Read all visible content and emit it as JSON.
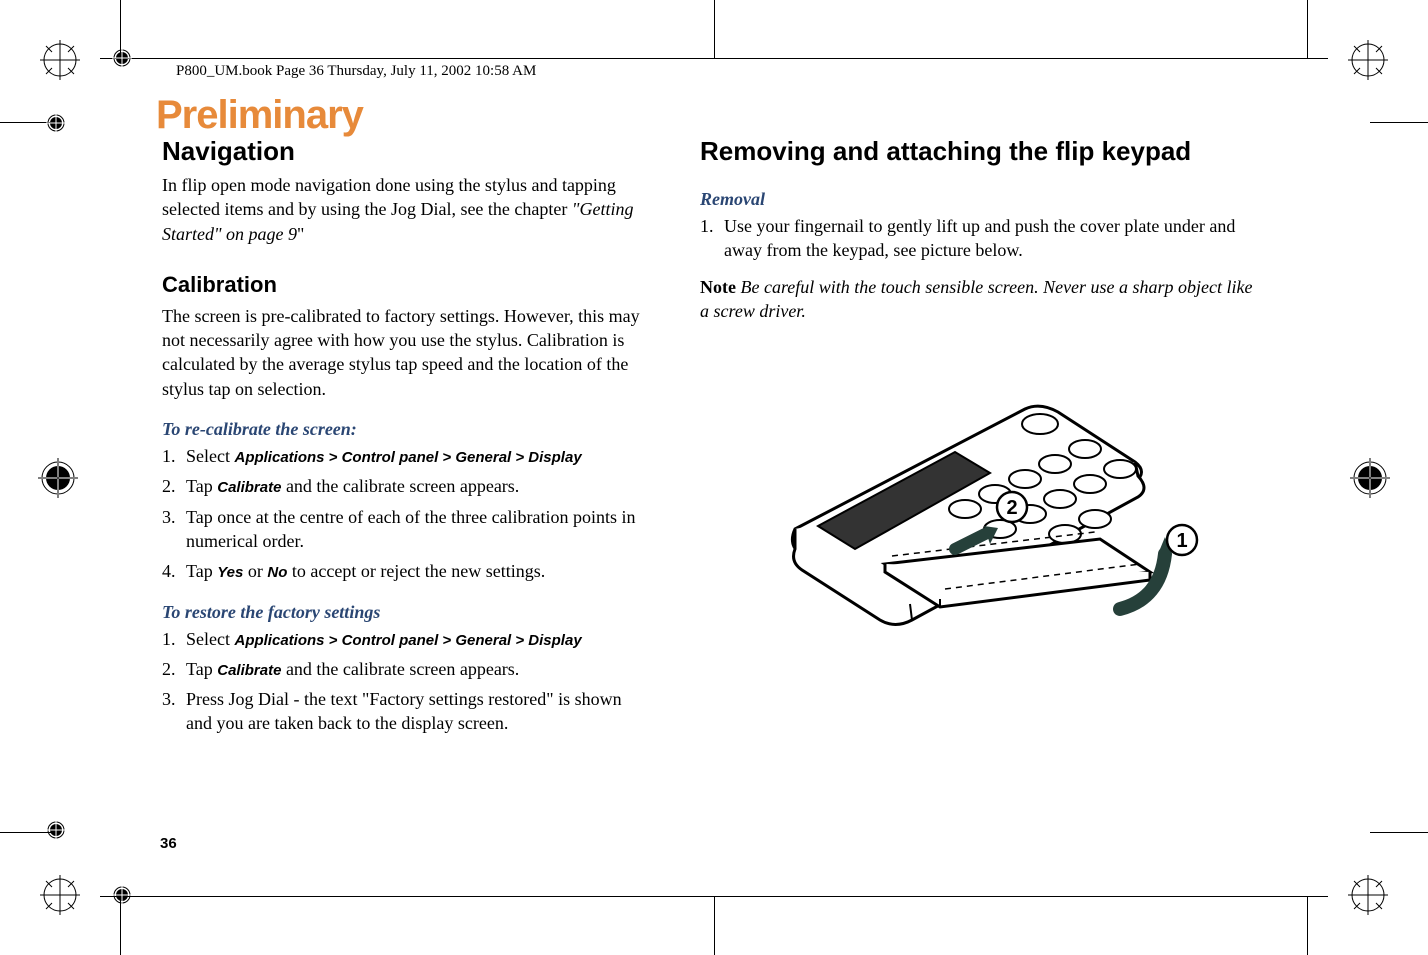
{
  "header": {
    "path": "P800_UM.book  Page 36  Thursday, July 11, 2002  10:58 AM"
  },
  "watermark": "Preliminary",
  "left_column": {
    "nav": {
      "heading": "Navigation",
      "para": "In flip open mode navigation done using the stylus and tapping selected items and by using the Jog Dial, see the chapter ",
      "ref": "\"Getting Started\" on page 9",
      "ref_after": "\""
    },
    "calibration": {
      "heading": "Calibration",
      "para": "The screen is pre-calibrated to factory settings. However, this may not necessarily agree with how you use the stylus. Calibration is calculated by the average stylus tap speed and the location of the stylus tap on selection.",
      "recalibrate": {
        "heading": "To re-calibrate the screen:",
        "step1_pre": "Select ",
        "step1_path": "Applications > Control panel > General  > Display",
        "step2_pre": "Tap ",
        "step2_label": "Calibrate",
        "step2_post": " and the calibrate screen appears.",
        "step3": "Tap once at the centre of each of the three calibration points in numerical order.",
        "step4_pre": "Tap ",
        "step4_yes": "Yes",
        "step4_or": " or ",
        "step4_no": "No",
        "step4_post": "  to accept or reject the new settings."
      },
      "restore": {
        "heading": "To restore the factory settings",
        "step1_pre": "Select ",
        "step1_path": "Applications > Control panel > General  > Display",
        "step2_pre": "Tap ",
        "step2_label": "Calibrate",
        "step2_post": " and the calibrate screen appears.",
        "step3": "Press Jog Dial - the text \"Factory settings restored\" is shown and you are taken back to the display screen."
      }
    }
  },
  "right_column": {
    "heading": "Removing and attaching the flip keypad",
    "removal": {
      "heading": "Removal",
      "step1": "Use your fingernail to gently lift up and push the cover plate under and away from the keypad, see picture below.",
      "note_label": "Note",
      "note_text": " Be careful with the touch sensible screen. Never use a sharp object like a screw driver."
    },
    "figure": {
      "callout1": "1",
      "callout2": "2"
    }
  },
  "page_number": "36"
}
